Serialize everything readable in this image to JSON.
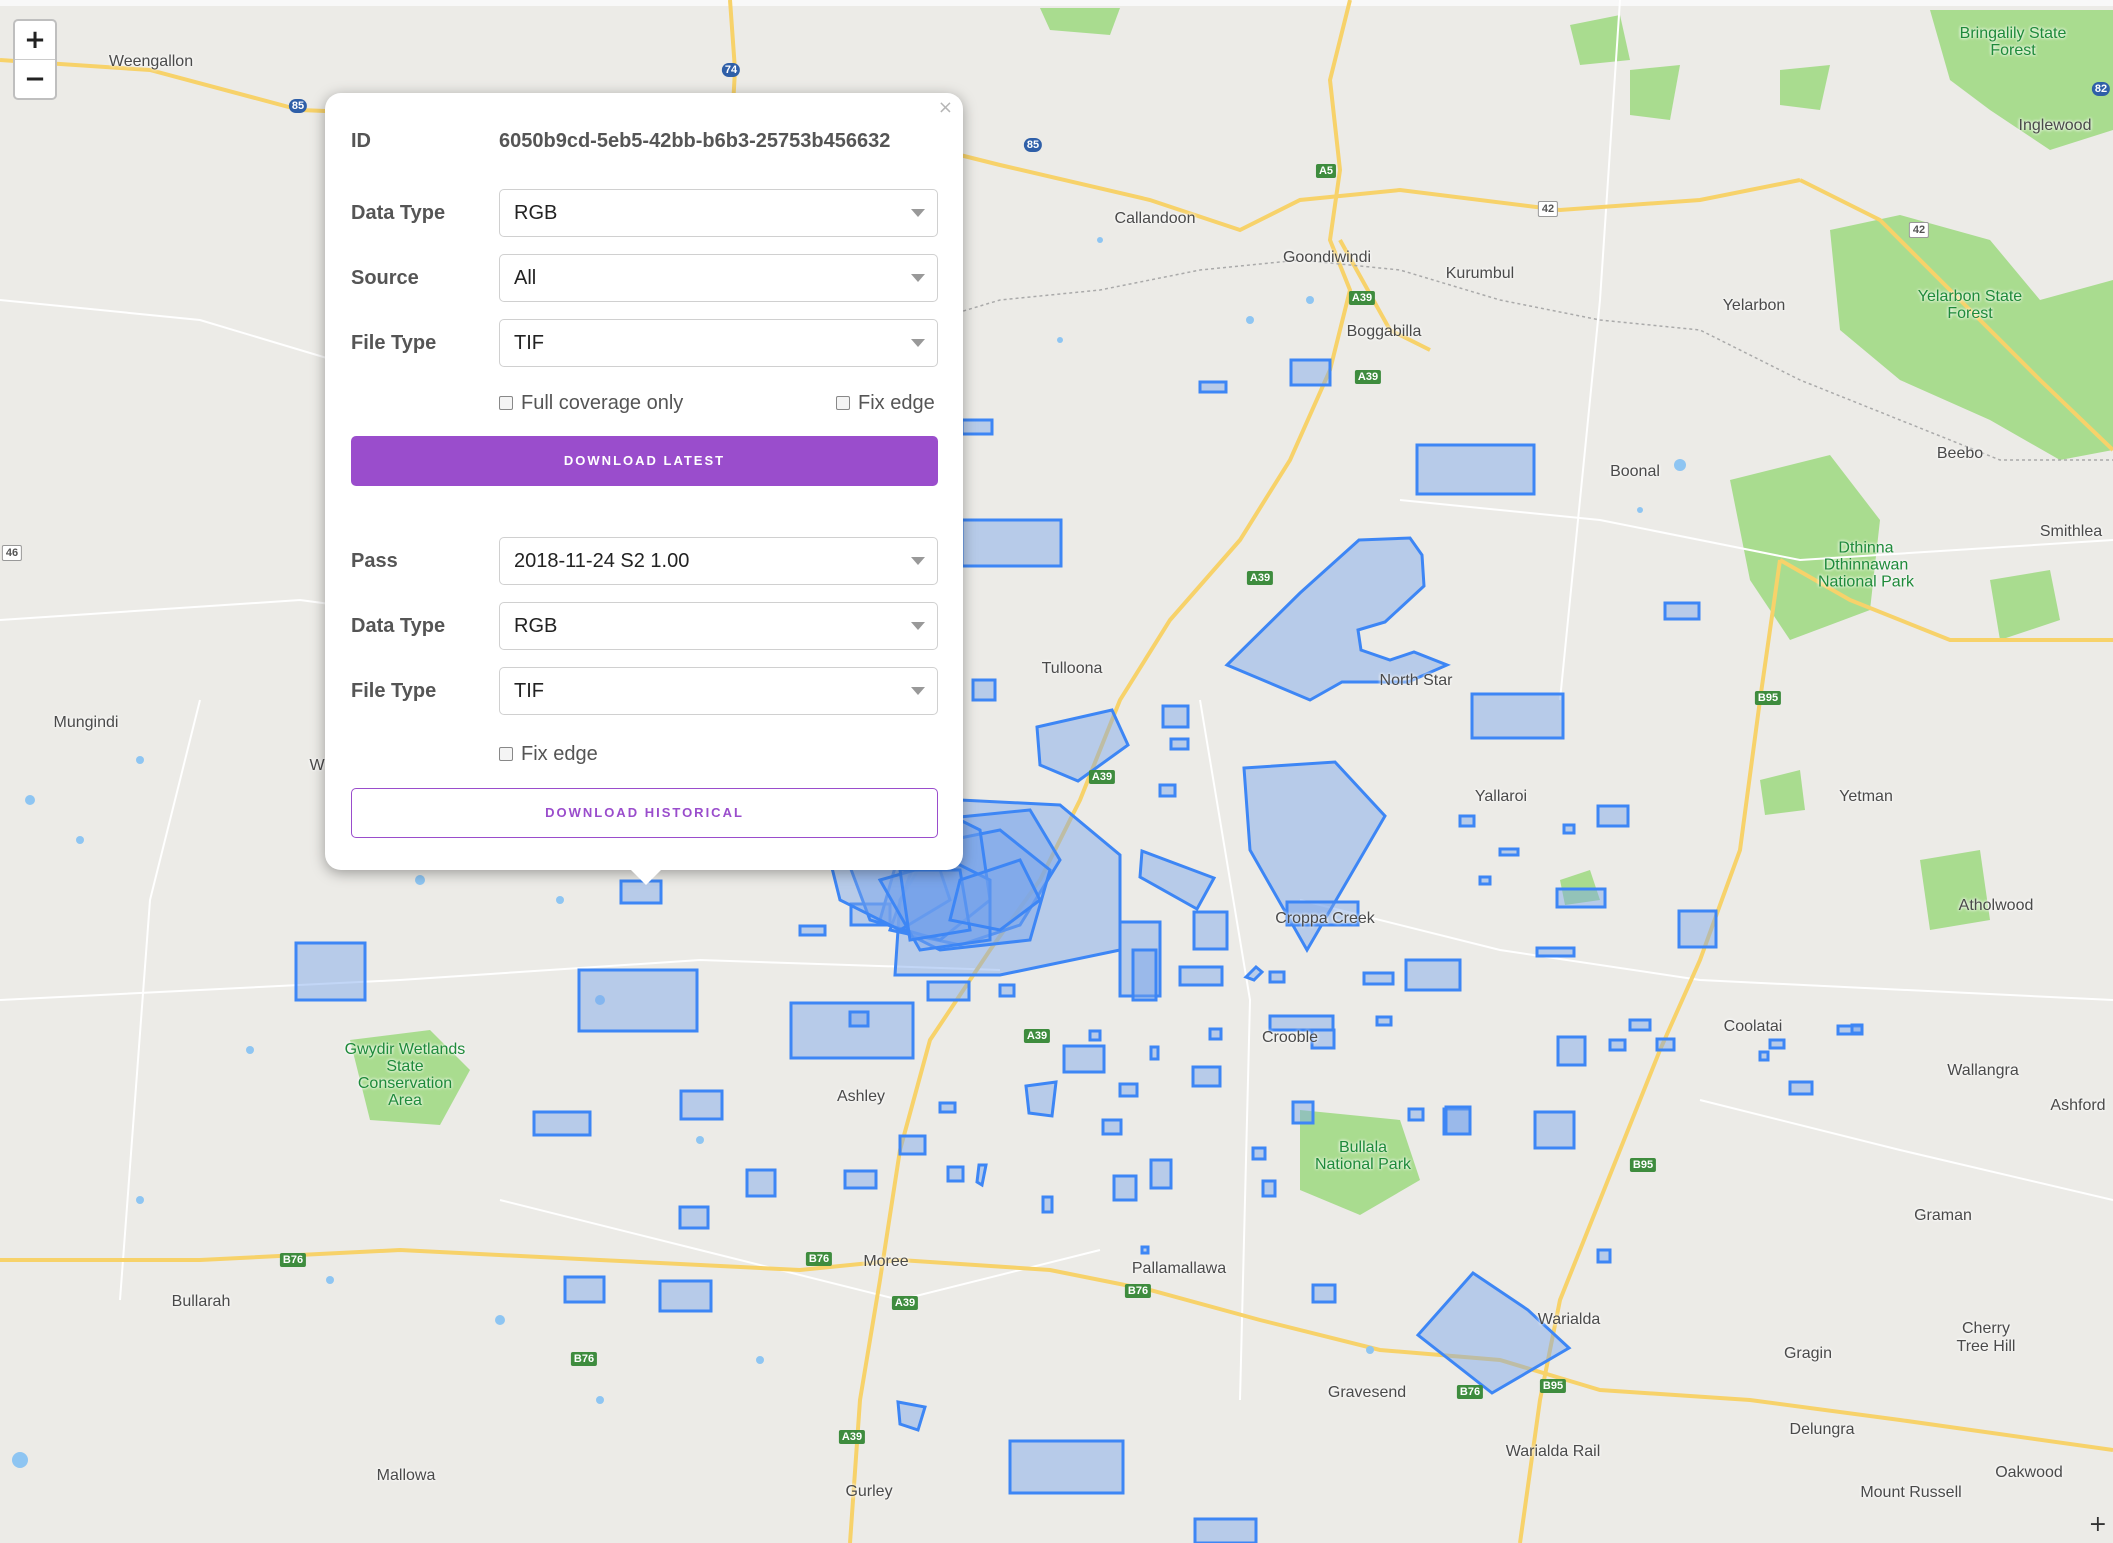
{
  "zoom": {
    "in_label": "+",
    "out_label": "−"
  },
  "colors": {
    "accent": "#9a4dcc",
    "polygon_stroke": "#3d86f5",
    "polygon_fill": "#a8c4ee",
    "road": "#f7d26a",
    "park": "#a9dc8f",
    "water": "#8ec5f2"
  },
  "map_labels": {
    "places": [
      "Weengallon",
      "Callandoon",
      "Goondiwindi",
      "Kurumbul",
      "Yelarbon",
      "Boggabilla",
      "Boonal",
      "Beebo",
      "Inglewood",
      "Smithlea",
      "Tulloona",
      "North Star",
      "Yallaroi",
      "Yetman",
      "Mungindi",
      "Atholwood",
      "Croppa Creek",
      "Crooble",
      "Coolatai",
      "Wallangra",
      "Ashford",
      "Ashley",
      "Moree",
      "Pallamallawa",
      "Bullarah",
      "Graman",
      "Warialda",
      "Gragin",
      "Cherry Tree Hill",
      "Gravesend",
      "Delungra",
      "Warialda Rail",
      "Oakwood",
      "Mallowa",
      "Gurley",
      "Mount Russell",
      "W"
    ],
    "parks": [
      "Bringalily State Forest",
      "Yelarbon State Forest",
      "Dthinna Dthinnawan National Park",
      "Gwydir Wetlands State Conservation Area",
      "Bullala National Park"
    ],
    "shields": [
      "85",
      "74",
      "85",
      "A5",
      "42",
      "42",
      "A39",
      "A39",
      "A39",
      "A39",
      "A39",
      "B95",
      "B95",
      "B95",
      "B76",
      "B76",
      "B76",
      "B76",
      "B76",
      "A39",
      "A39",
      "46",
      "82"
    ]
  },
  "popup": {
    "close_label": "×",
    "id_label": "ID",
    "id_value": "6050b9cd-5eb5-42bb-b6b3-25753b456632",
    "latest": {
      "data_type_label": "Data Type",
      "data_type_value": "RGB",
      "source_label": "Source",
      "source_value": "All",
      "file_type_label": "File Type",
      "file_type_value": "TIF",
      "full_coverage_label": "Full coverage only",
      "fix_edge_label": "Fix edge",
      "download_label": "DOWNLOAD LATEST"
    },
    "historical": {
      "pass_label": "Pass",
      "pass_value": "2018-11-24 S2 1.00",
      "data_type_label": "Data Type",
      "data_type_value": "RGB",
      "file_type_label": "File Type",
      "file_type_value": "TIF",
      "fix_edge_label": "Fix edge",
      "download_label": "DOWNLOAD HISTORICAL"
    }
  },
  "corner_icon": "+"
}
